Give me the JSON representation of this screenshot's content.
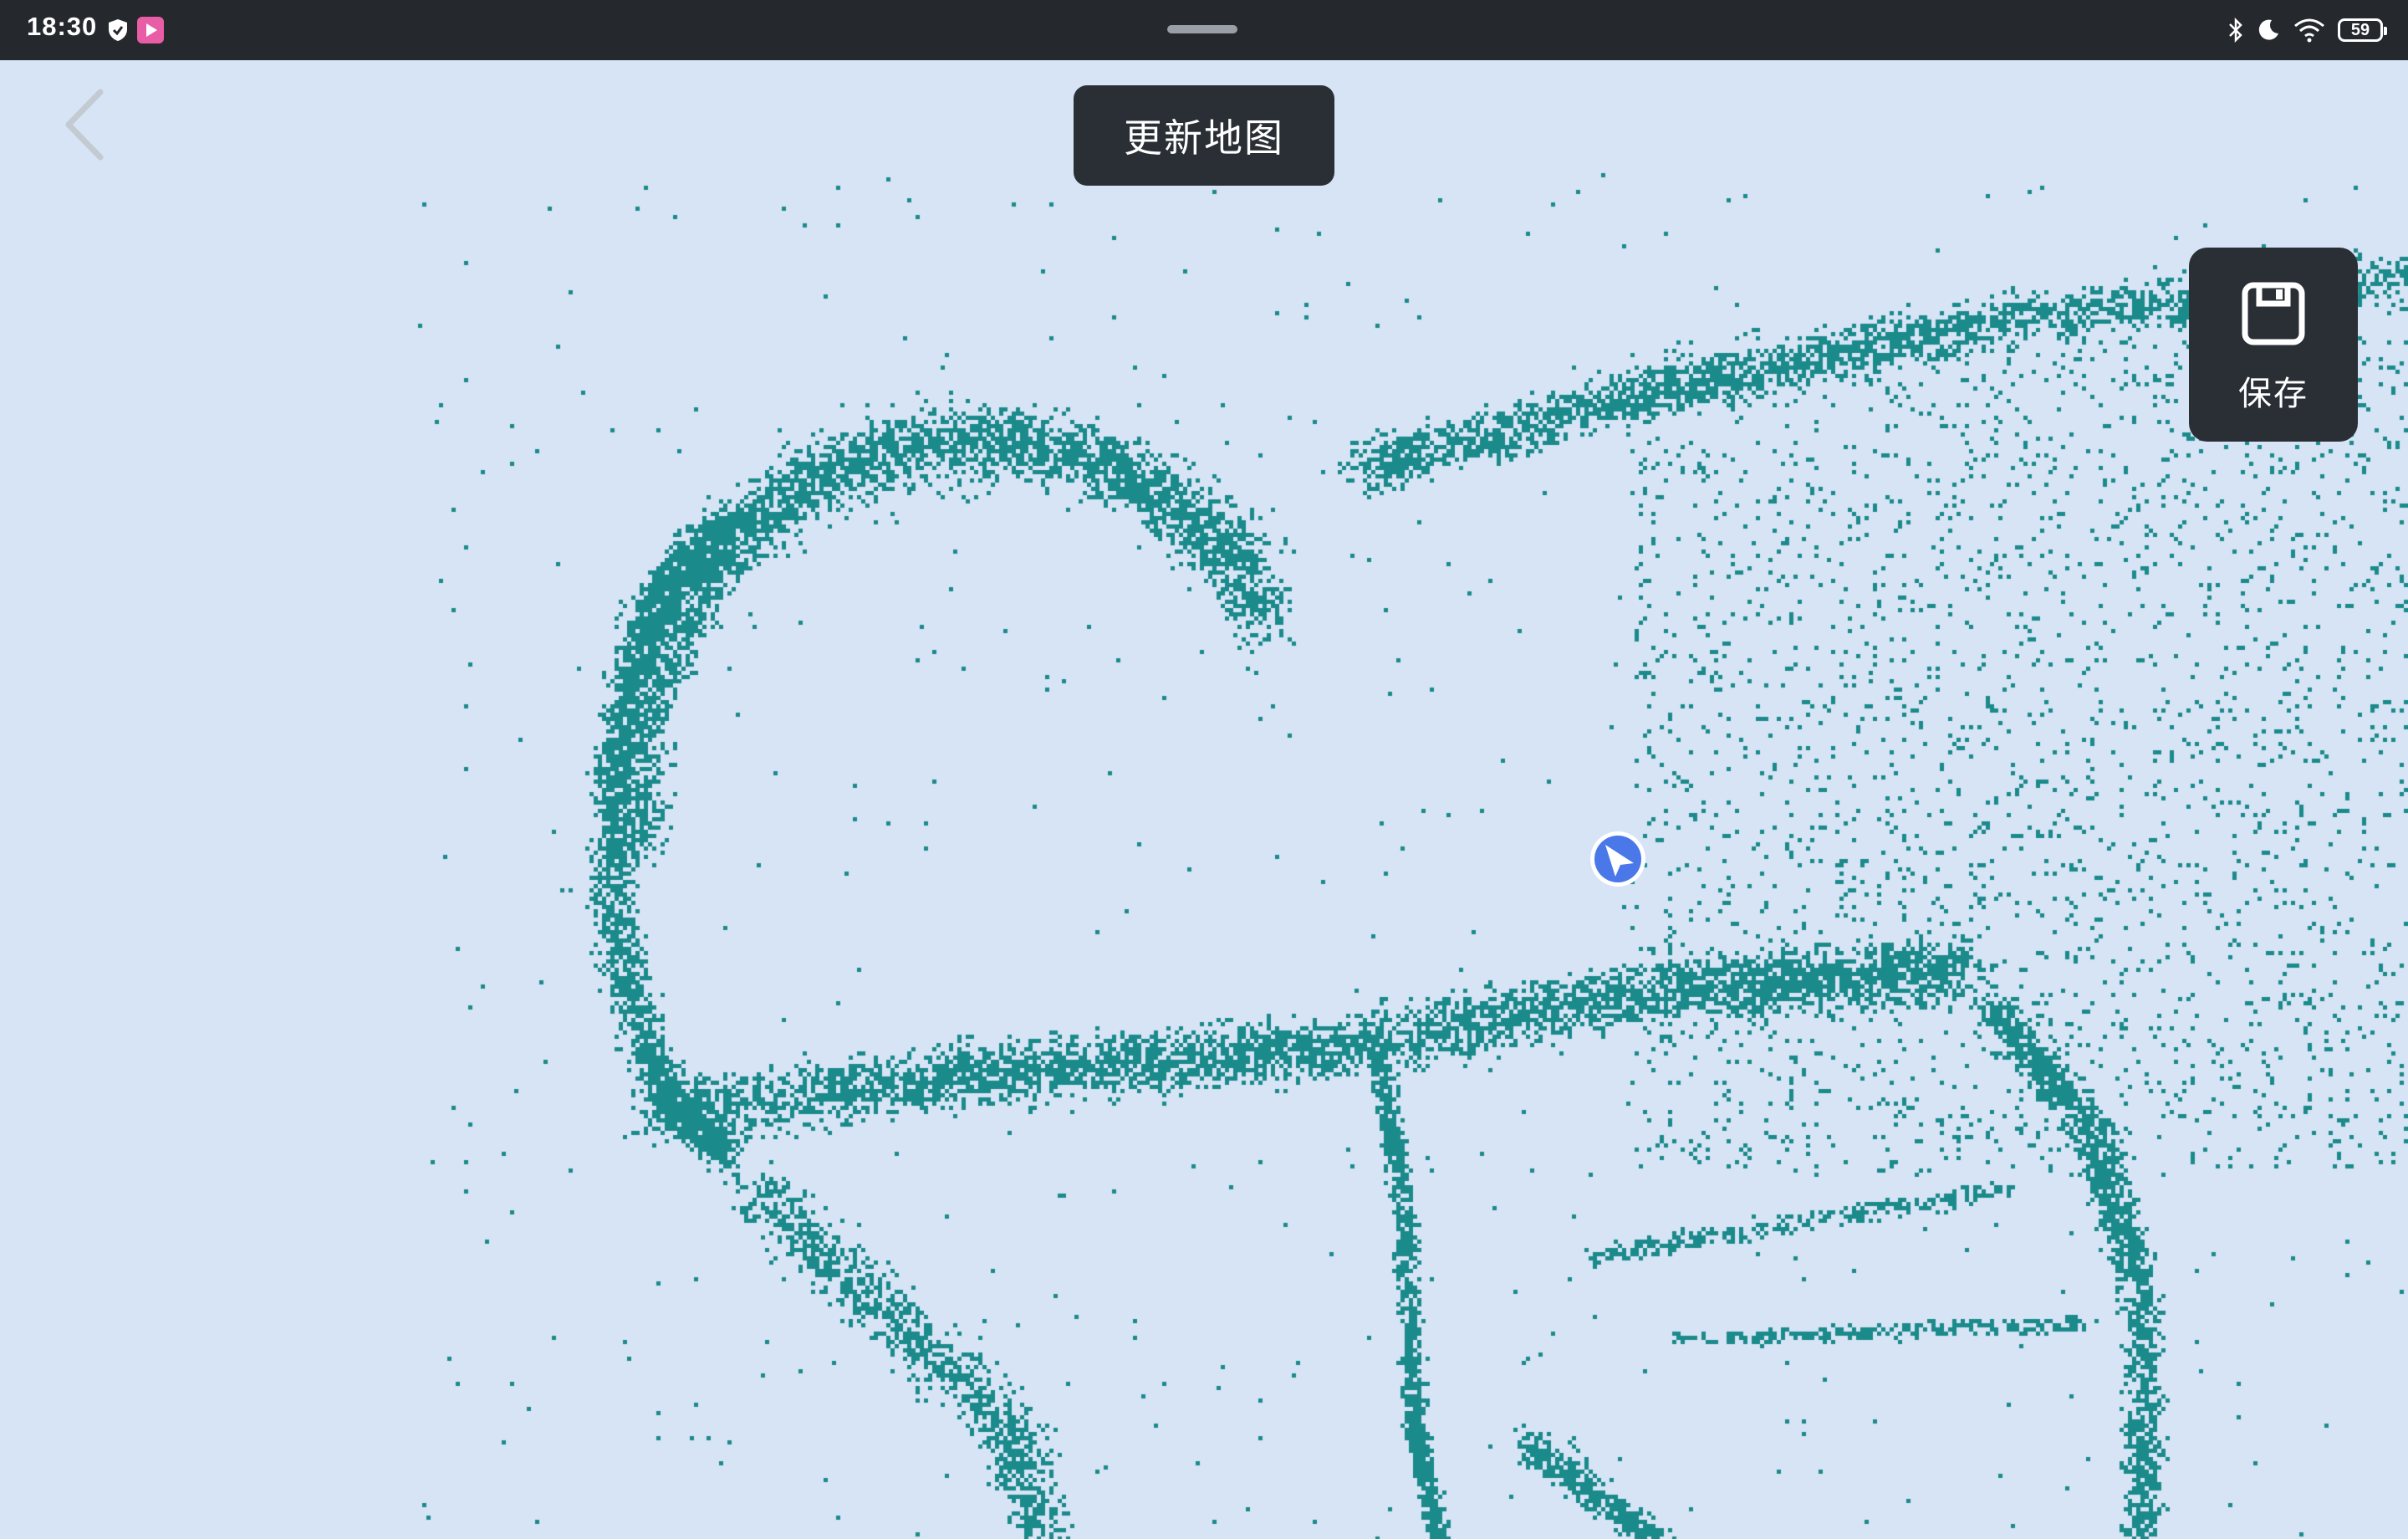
{
  "status_bar": {
    "time": "18:30",
    "battery": "59",
    "icons": [
      "shield-icon",
      "app-icon",
      "bluetooth-icon",
      "moon-icon",
      "wifi-icon",
      "battery-icon"
    ]
  },
  "toolbar": {
    "back_icon": "chevron-left-icon",
    "update_map_label": "更新地图",
    "save_label": "保存",
    "save_icon": "floppy-disk-icon"
  },
  "map": {
    "point_color": "#1a8a8a",
    "background_color": "#d6e4f5",
    "robot_marker_color": "#4a78e8"
  }
}
